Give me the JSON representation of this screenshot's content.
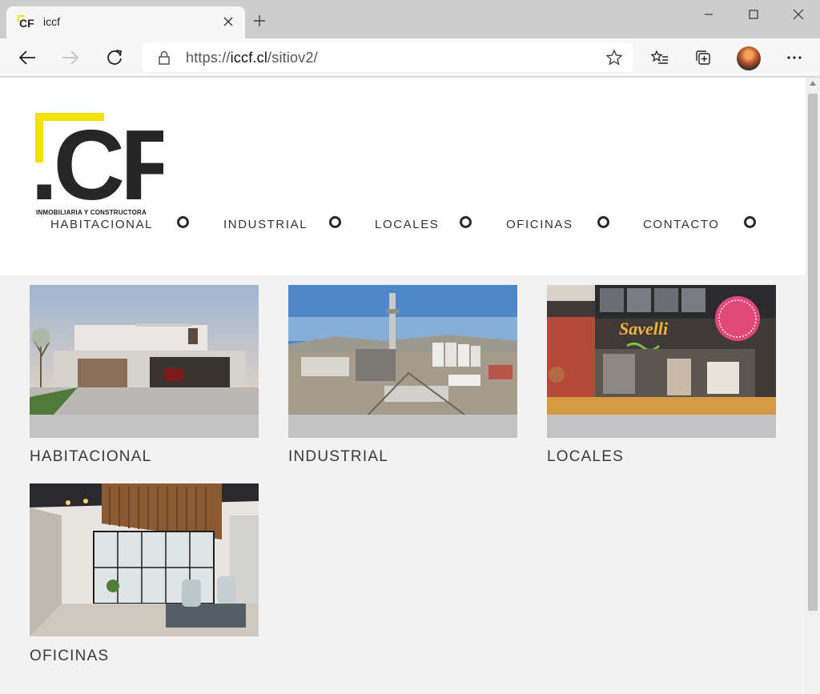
{
  "browser": {
    "tab_title": "iccf",
    "favicon_text": "CF",
    "url_scheme": "https://",
    "url_host": "iccf.cl",
    "url_path": "/sitiov2/"
  },
  "site": {
    "logo_letters": ".CF",
    "logo_subtitle": "INMOBILIARIA Y CONSTRUCTORA",
    "brand_colors": {
      "accent": "#f5e100",
      "dark": "#262626"
    },
    "nav": [
      {
        "label": "HABITACIONAL"
      },
      {
        "label": "INDUSTRIAL"
      },
      {
        "label": "LOCALES"
      },
      {
        "label": "OFICINAS"
      },
      {
        "label": "CONTACTO"
      }
    ],
    "categories": [
      {
        "label": "HABITACIONAL",
        "image": "modern-house-photo"
      },
      {
        "label": "INDUSTRIAL",
        "image": "industrial-plant-photo"
      },
      {
        "label": "LOCALES",
        "image": "storefront-photo",
        "sign_text": "Savelli"
      },
      {
        "label": "OFICINAS",
        "image": "office-interior-photo"
      }
    ]
  }
}
